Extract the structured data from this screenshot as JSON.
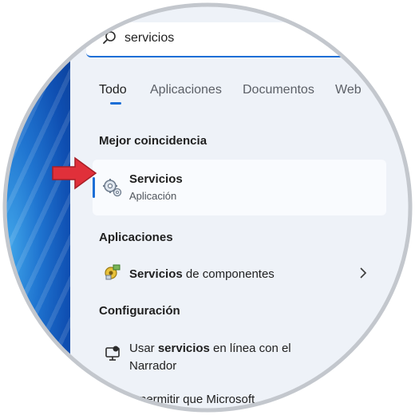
{
  "search": {
    "value": "servicios",
    "icon": "search-icon"
  },
  "tabs": [
    {
      "label": "Todo",
      "active": true
    },
    {
      "label": "Aplicaciones",
      "active": false
    },
    {
      "label": "Documentos",
      "active": false
    },
    {
      "label": "Web",
      "active": false
    }
  ],
  "best_match": {
    "heading": "Mejor coincidencia",
    "title": "Servicios",
    "subtitle": "Aplicación",
    "icon": "services-gear-icon"
  },
  "apps": {
    "heading": "Aplicaciones",
    "item_bold": "Servicios",
    "item_rest": " de componentes",
    "icon": "component-services-icon"
  },
  "settings": {
    "heading": "Configuración",
    "item_line1_pre": "Usar ",
    "item_line1_bold": "servicios",
    "item_line1_post": " en línea con el",
    "item_line2": "Narrador",
    "item_partial": "permitir que Microsoft",
    "icon": "narrator-icon"
  },
  "colors": {
    "accent": "#1c6ed6",
    "panel": "#eef2f8",
    "arrow": "#e0303a"
  }
}
